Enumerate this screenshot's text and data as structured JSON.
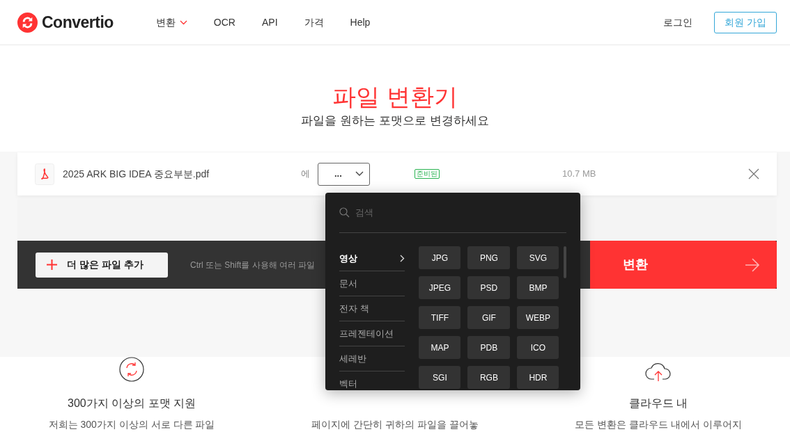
{
  "header": {
    "logo": "Convertio",
    "nav": [
      {
        "label": "변환",
        "dropdown": true
      },
      {
        "label": "OCR",
        "dropdown": false
      },
      {
        "label": "API",
        "dropdown": false
      },
      {
        "label": "가격",
        "dropdown": false
      },
      {
        "label": "Help",
        "dropdown": false
      }
    ],
    "login": "로그인",
    "signup": "회원 가입"
  },
  "hero": {
    "title": "파일 변환기",
    "subtitle": "파일을 원하는 포맷으로 변경하세요"
  },
  "file": {
    "name": "2025 ARK BIG IDEA 중요부분.pdf",
    "to_label": "에",
    "format": "...",
    "status": "준비된",
    "size": "10.7 MB"
  },
  "actions": {
    "add_button": "더 많은 파일 추가",
    "hint": "Ctrl 또는 Shift를 사용해 여러 파일",
    "convert_button": "변환"
  },
  "format_menu": {
    "search": {
      "placeholder": "검색"
    },
    "categories": [
      {
        "label": "영상",
        "selected": true
      },
      {
        "label": "문서",
        "selected": false
      },
      {
        "label": "전자 책",
        "selected": false
      },
      {
        "label": "프레젠테이션",
        "selected": false
      },
      {
        "label": "세레반",
        "selected": false
      },
      {
        "label": "벡터",
        "selected": false
      }
    ],
    "formats": [
      "JPG",
      "PNG",
      "SVG",
      "JPEG",
      "PSD",
      "BMP",
      "TIFF",
      "GIF",
      "WEBP",
      "MAP",
      "PDB",
      "ICO",
      "SGI",
      "RGB",
      "HDR"
    ]
  },
  "features": [
    {
      "kind": "formats",
      "title": "300가지 이상의 포맷 지원",
      "text": "저희는 300가지 이상의 서로 다른 파일"
    },
    {
      "kind": "speed",
      "text": "페이지에 간단히 귀하의 파일을 끌어놓"
    },
    {
      "kind": "cloud",
      "title": "클라우드 내",
      "text": "모든 변환은 클라우드 내에서 이루어지"
    }
  ]
}
